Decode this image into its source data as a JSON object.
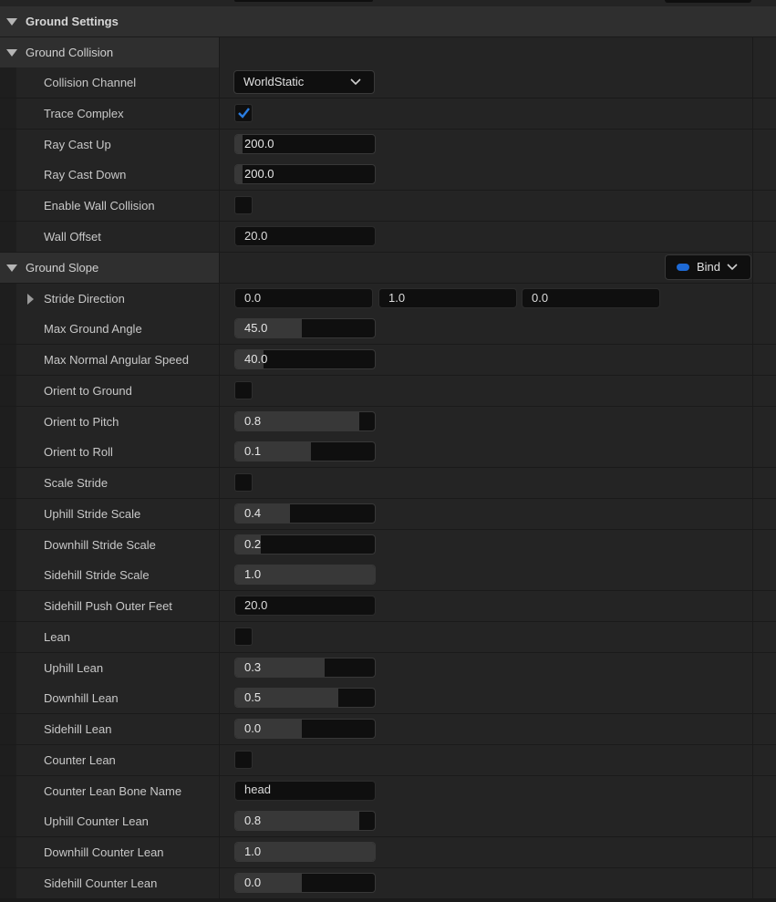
{
  "sections": {
    "ground_settings": "Ground Settings",
    "ground_collision": "Ground Collision",
    "ground_slope": "Ground Slope"
  },
  "collision": {
    "collision_channel": {
      "label": "Collision Channel",
      "value": "WorldStatic"
    },
    "trace_complex": {
      "label": "Trace Complex",
      "checked": true
    },
    "ray_cast_up": {
      "label": "Ray Cast Up",
      "value": "200.0"
    },
    "ray_cast_down": {
      "label": "Ray Cast Down",
      "value": "200.0"
    },
    "enable_wall_collision": {
      "label": "Enable Wall Collision",
      "checked": false
    },
    "wall_offset": {
      "label": "Wall Offset",
      "value": "20.0"
    }
  },
  "slope": {
    "bind_label": "Bind",
    "stride_direction": {
      "label": "Stride Direction",
      "x": "0.0",
      "y": "1.0",
      "z": "0.0"
    },
    "max_ground_angle": {
      "label": "Max Ground Angle",
      "value": "45.0"
    },
    "max_normal_angular_speed": {
      "label": "Max Normal Angular Speed",
      "value": "40.0"
    },
    "orient_to_ground": {
      "label": "Orient to Ground",
      "checked": false
    },
    "orient_to_pitch": {
      "label": "Orient to Pitch",
      "value": "0.8"
    },
    "orient_to_roll": {
      "label": "Orient to Roll",
      "value": "0.1"
    },
    "scale_stride": {
      "label": "Scale Stride",
      "checked": false
    },
    "uphill_stride_scale": {
      "label": "Uphill Stride Scale",
      "value": "0.4"
    },
    "downhill_stride_scale": {
      "label": "Downhill Stride Scale",
      "value": "0.2"
    },
    "sidehill_stride_scale": {
      "label": "Sidehill Stride Scale",
      "value": "1.0"
    },
    "sidehill_push_outer_feet": {
      "label": "Sidehill Push Outer Feet",
      "value": "20.0"
    },
    "lean": {
      "label": "Lean",
      "checked": false
    },
    "uphill_lean": {
      "label": "Uphill Lean",
      "value": "0.3"
    },
    "downhill_lean": {
      "label": "Downhill Lean",
      "value": "0.5"
    },
    "sidehill_lean": {
      "label": "Sidehill Lean",
      "value": "0.0"
    },
    "counter_lean": {
      "label": "Counter Lean",
      "checked": false
    },
    "counter_lean_bone_name": {
      "label": "Counter Lean Bone Name",
      "value": "head"
    },
    "uphill_counter_lean": {
      "label": "Uphill Counter Lean",
      "value": "0.8"
    },
    "downhill_counter_lean": {
      "label": "Downhill Counter Lean",
      "value": "1.0"
    },
    "sidehill_counter_lean": {
      "label": "Sidehill Counter Lean",
      "value": "0.0"
    }
  },
  "slider_fill": {
    "ray_cast_up": 0.05,
    "ray_cast_down": 0.05,
    "max_ground_angle": 0.48,
    "max_normal_angular_speed": 0.2,
    "orient_to_pitch": 0.89,
    "orient_to_roll": 0.54,
    "uphill_stride_scale": 0.39,
    "downhill_stride_scale": 0.18,
    "sidehill_stride_scale": 1.0,
    "uphill_lean": 0.64,
    "downhill_lean": 0.74,
    "sidehill_lean": 0.48,
    "uphill_counter_lean": 0.89,
    "downhill_counter_lean": 1.0,
    "sidehill_counter_lean": 0.48
  },
  "colors": {
    "accent": "#1e6ad6",
    "check": "#2a7de1"
  }
}
